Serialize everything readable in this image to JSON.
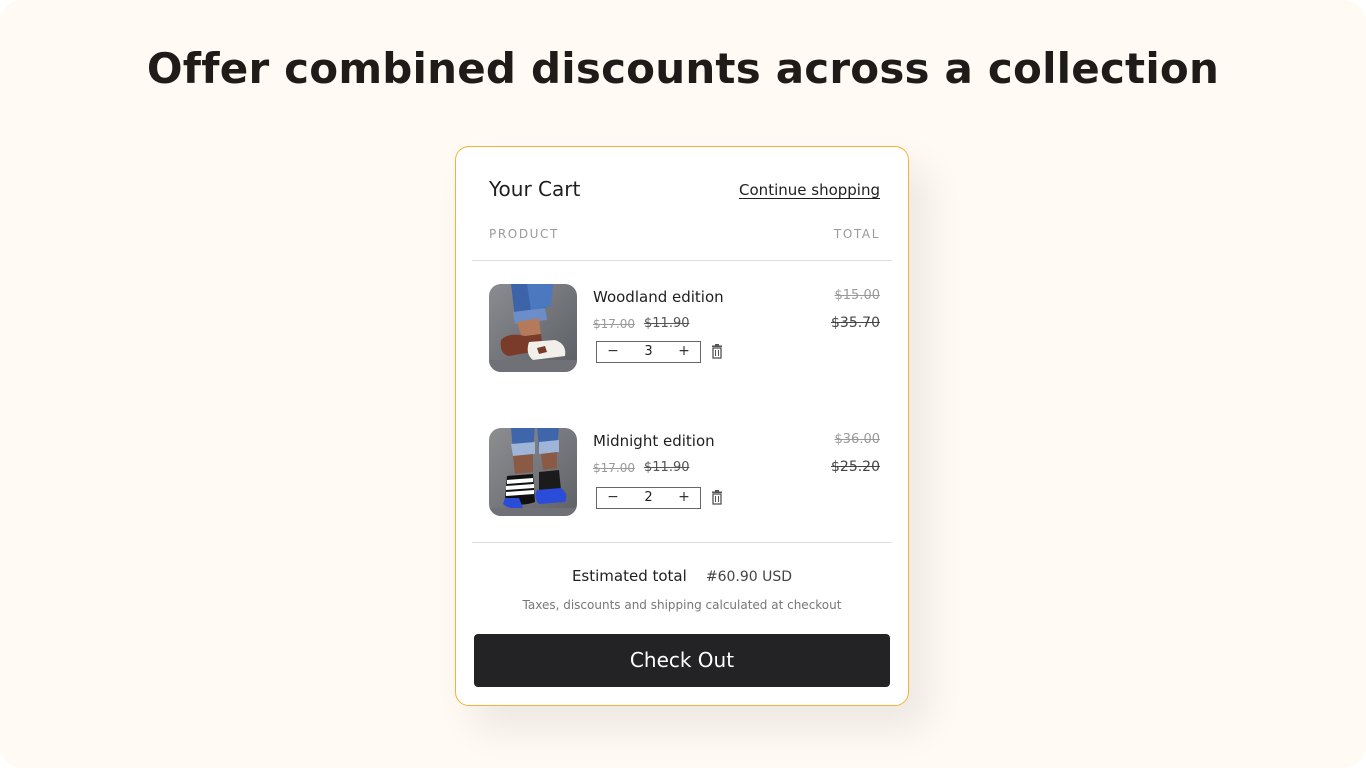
{
  "headline": "Offer combined discounts across a collection",
  "cart": {
    "title": "Your Cart",
    "continue_label": "Continue shopping",
    "col_product": "PRODUCT",
    "col_total": "TOTAL",
    "items": [
      {
        "name": "Woodland edition",
        "price_original": "$17.00",
        "price_sale": "$11.90",
        "quantity": "3",
        "total_original": "$15.00",
        "total_sale": "$35.70"
      },
      {
        "name": "Midnight edition",
        "price_original": "$17.00",
        "price_sale": "$11.90",
        "quantity": "2",
        "total_original": "$36.00",
        "total_sale": "$25.20"
      }
    ],
    "qty_minus": "−",
    "qty_plus": "+",
    "estimated_label": "Estimated total",
    "estimated_value": "#60.90 USD",
    "tax_note": "Taxes, discounts and shipping calculated at checkout",
    "checkout_label": "Check Out"
  },
  "colors": {
    "page_bg": "#fffaf3",
    "cart_border": "#f5b13a",
    "checkout_bg": "#232325"
  }
}
